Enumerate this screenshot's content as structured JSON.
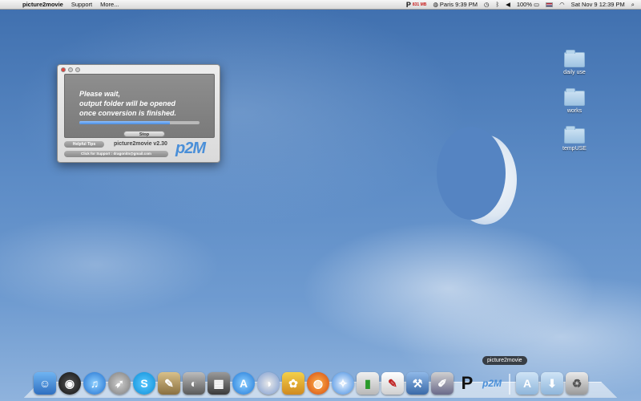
{
  "menubar": {
    "apple_icon": "apple-icon",
    "app_name": "picture2movie",
    "menus": [
      "Support",
      "More..."
    ],
    "status": {
      "memory_value": "831 MB",
      "clock_world": "Paris 9:39 PM",
      "battery": "100%",
      "datetime": "Sat Nov 9  12:39 PM"
    }
  },
  "desktop_icons": [
    {
      "label": "daily use"
    },
    {
      "label": "works"
    },
    {
      "label": "tempUSE"
    }
  ],
  "window": {
    "message_line1": "Please wait,",
    "message_line2": "output folder will be opened",
    "message_line3": "once conversion is finished.",
    "progress_percent": 75,
    "stop_label": "Stop",
    "tips_label": "Helpful Tips",
    "version": "picture2movie v2.30",
    "support_label": "Click for Support : dragonitn@gmail.com",
    "logo": "p2M"
  },
  "dock": {
    "tooltip": "picture2movie",
    "apps": [
      "finder",
      "dashboard",
      "itunes",
      "launchpad",
      "skype",
      "preview",
      "facetime",
      "photo-booth",
      "app-store",
      "google-earth",
      "paint",
      "firefox",
      "safari",
      "charts",
      "textedit",
      "xcode",
      "brush",
      "p-app",
      "p2m"
    ],
    "accent_color": "#4a8fd8"
  }
}
